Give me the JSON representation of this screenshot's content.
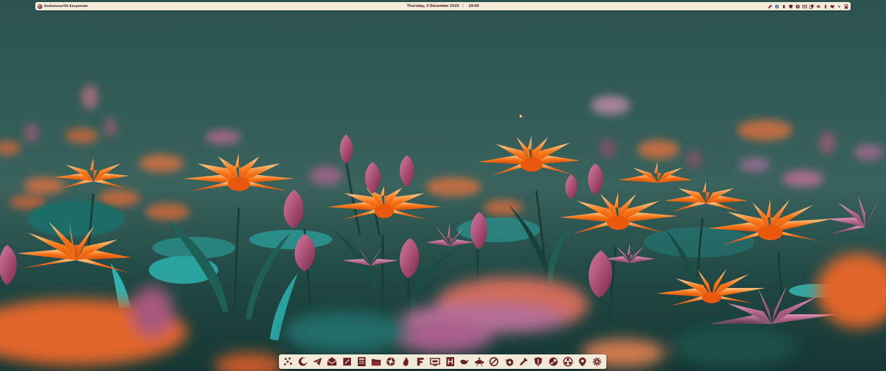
{
  "top_panel": {
    "os_title": "EndeavourOS Easymode",
    "clock": {
      "date": "Thursday, 4 December 2025",
      "time": "18:00",
      "weather_icon": "moon-cloud-icon"
    },
    "tray_icons": [
      "pen-icon",
      "globe-icon",
      "flame-icon",
      "shield-icon",
      "record-icon",
      "mail-icon",
      "copy-icon",
      "volume-icon",
      "bluetooth-icon",
      "heart-icon",
      "chevron-down-icon",
      "battery-icon"
    ]
  },
  "dock": {
    "items": [
      "launcher-icon",
      "eclipse-icon",
      "telegram-icon",
      "mail-icon",
      "notes-icon",
      "library-icon",
      "folder-icon",
      "aperture-icon",
      "fire-icon",
      "font-icon",
      "display-icon",
      "hexchat-icon",
      "bird-icon",
      "ufo-icon",
      "blocked-icon",
      "blender-icon",
      "eyedropper-icon",
      "shield-alert-icon",
      "steam-icon",
      "obs-icon",
      "location-icon",
      "settings-icon"
    ]
  },
  "colors": {
    "panel_bg": "#f4ecd9",
    "icon_color": "#6b1f2a",
    "wallpaper_sky": "#2c5350"
  }
}
